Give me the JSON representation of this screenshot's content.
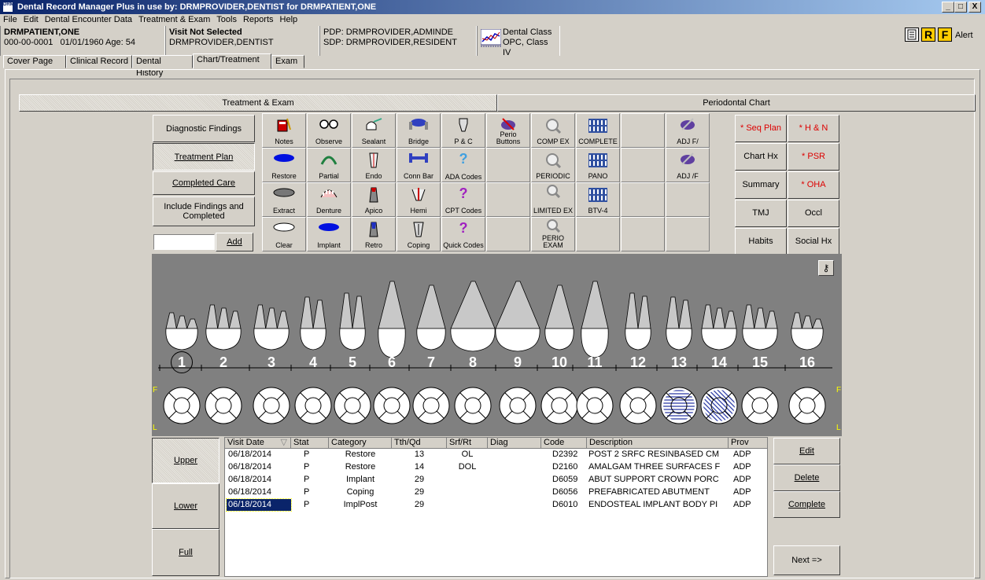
{
  "window": {
    "title": "Dental Record Manager Plus in use by: DRMPROVIDER,DENTIST for DRMPATIENT,ONE",
    "icon_text": "DRM",
    "controls": [
      "_",
      "□",
      "X"
    ]
  },
  "menu": [
    "File",
    "Edit",
    "Dental Encounter Data",
    "Treatment & Exam",
    "Tools",
    "Reports",
    "Help"
  ],
  "patient": {
    "name": "DRMPATIENT,ONE",
    "id_line": "000-00-0001   01/01/1960 Age: 54"
  },
  "visit": {
    "status": "Visit Not Selected",
    "provider": "DRMPROVIDER,DENTIST"
  },
  "providers": {
    "pdp": "PDP: DRMPROVIDER,ADMINDE",
    "sdp": "SDP: DRMPROVIDER,RESIDENT"
  },
  "dental_class": {
    "line1": "Dental Class",
    "line2": "OPC, Class IV"
  },
  "alerts": {
    "r": "R",
    "f": "F",
    "alert_label": "Alert"
  },
  "tabs": [
    "Cover Page",
    "Clinical Record",
    "Dental History",
    "Chart/Treatment",
    "Exam"
  ],
  "section_tabs": {
    "left": "Treatment & Exam",
    "right": "Periodontal Chart"
  },
  "mode_buttons": [
    "Diagnostic Findings",
    "Treatment Plan",
    "Completed Care",
    "Include Findings and Completed"
  ],
  "add_button": "Add",
  "add_input": "",
  "tool_grid": [
    [
      "Notes",
      "Observe",
      "Sealant",
      "Bridge",
      "P & C",
      "Perio Buttons",
      "COMP EX",
      "COMPLETE",
      "",
      "ADJ F/"
    ],
    [
      "Restore",
      "Partial",
      "Endo",
      "Conn Bar",
      "ADA Codes",
      "",
      "PERIODIC",
      "PANO",
      "",
      "ADJ /F"
    ],
    [
      "Extract",
      "Denture",
      "Apico",
      "Hemi",
      "CPT Codes",
      "",
      "LIMITED EX",
      "BTV-4",
      "",
      ""
    ],
    [
      "Clear",
      "Implant",
      "Retro",
      "Coping",
      "Quick Codes",
      "",
      "PERIO EXAM",
      "",
      "",
      ""
    ]
  ],
  "right_buttons": [
    [
      "* Seq Plan",
      "* H & N"
    ],
    [
      "Chart Hx",
      "* PSR"
    ],
    [
      "Summary",
      "* OHA"
    ],
    [
      "TMJ",
      "Occl"
    ],
    [
      "Habits",
      "Social Hx"
    ]
  ],
  "tooth_numbers": [
    "1",
    "2",
    "3",
    "4",
    "5",
    "6",
    "7",
    "8",
    "9",
    "10",
    "11",
    "12",
    "13",
    "14",
    "15",
    "16"
  ],
  "side_labels": {
    "top": "F",
    "bottom": "L"
  },
  "arch_buttons": [
    "Upper",
    "Lower",
    "Full"
  ],
  "table": {
    "headers": [
      "Visit Date",
      "Stat",
      "Category",
      "Tth/Qd",
      "Srf/Rt",
      "Diag",
      "Code",
      "Description",
      "Prov"
    ],
    "rows": [
      [
        "06/18/2014",
        "P",
        "Restore",
        "13",
        "OL",
        "",
        "D2392",
        "POST 2 SRFC RESINBASED CM",
        "ADP"
      ],
      [
        "06/18/2014",
        "P",
        "Restore",
        "14",
        "DOL",
        "",
        "D2160",
        "AMALGAM THREE SURFACES F",
        "ADP"
      ],
      [
        "06/18/2014",
        "P",
        "Implant",
        "29",
        "",
        "",
        "D6059",
        "ABUT SUPPORT CROWN PORC",
        "ADP"
      ],
      [
        "06/18/2014",
        "P",
        "Coping",
        "29",
        "",
        "",
        "D6056",
        "PREFABRICATED ABUTMENT",
        "ADP"
      ],
      [
        "06/18/2014",
        "P",
        "ImplPost",
        "29",
        "",
        "",
        "D6010",
        "ENDOSTEAL IMPLANT BODY PI",
        "ADP"
      ]
    ]
  },
  "action_buttons": [
    "Edit",
    "Delete",
    "Complete"
  ],
  "next_button": "Next =>"
}
